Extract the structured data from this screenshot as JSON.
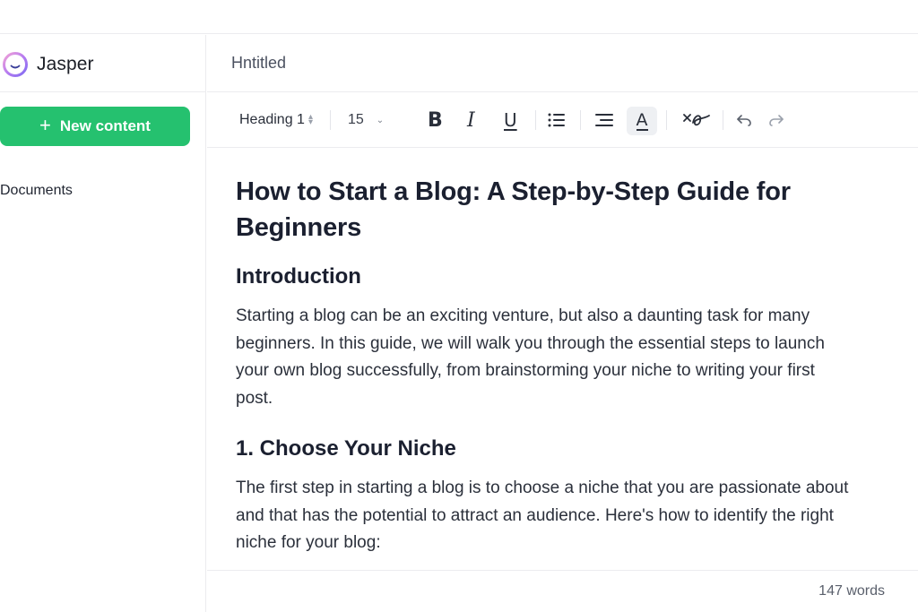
{
  "brand": {
    "name": "Jasper",
    "logo_icon": "jasper-logo-icon"
  },
  "sidebar": {
    "new_content_label": "New content",
    "documents_label": "Documents"
  },
  "document": {
    "title": "Hntitled"
  },
  "toolbar": {
    "block_type": "Heading 1",
    "font_size": "15",
    "bold_label": "B",
    "italic_label": "I",
    "underline_label": "U",
    "text_color_label": "A",
    "icons": [
      "bulleted-list-icon",
      "align-icon",
      "translate-icon",
      "undo-icon",
      "redo-icon"
    ]
  },
  "content": {
    "title": "How to Start a Blog: A Step-by-Step Guide for Beginners",
    "sections": [
      {
        "heading": "Introduction",
        "body": "Starting a blog can be an exciting venture, but also a daunting task for many beginners. In this guide, we will walk you through the essential steps to launch your own blog successfully, from brainstorming your niche to writing your first post."
      },
      {
        "heading": "1. Choose Your Niche",
        "body": "The first step in starting a blog is  to choose a niche that you are passionate about and that has the potential to attract an audience. Here's how to identify the right niche for your blog:"
      }
    ]
  },
  "footer": {
    "word_count": "147 words"
  },
  "colors": {
    "accent_green": "#25c16f",
    "text_dark": "#1b2030",
    "border": "#ececef"
  }
}
